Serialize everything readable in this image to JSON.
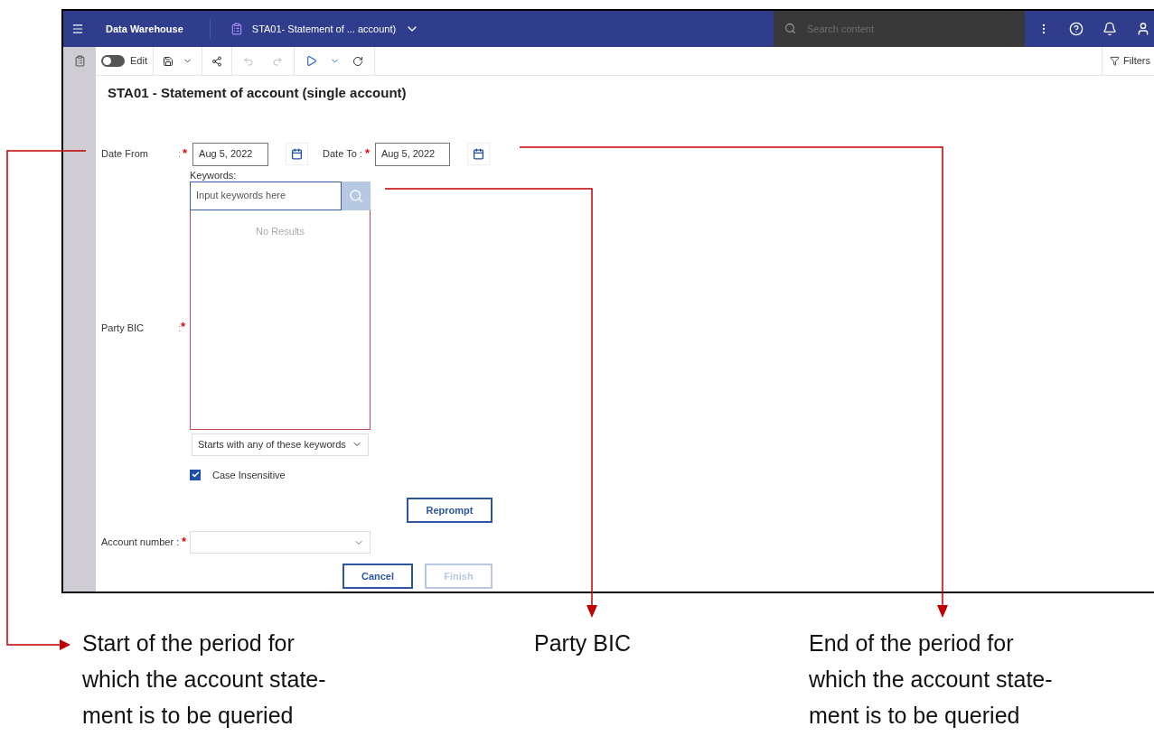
{
  "app_bar": {
    "title": "Data Warehouse",
    "report_tab": "STA01- Statement of ... account)",
    "search": {
      "placeholder": "Search content"
    }
  },
  "toolbar": {
    "edit_toggle": {
      "label": "Edit",
      "on": false
    },
    "filters": "Filters"
  },
  "report_title": "STA01 - Statement of account (single account)",
  "form": {
    "date_from": {
      "label": "Date From",
      "separator": ":",
      "required_mark": "*",
      "value": "Aug 5, 2022"
    },
    "date_to": {
      "label": "Date To :",
      "required_mark": "*",
      "value": "Aug 5, 2022"
    },
    "party_bic": {
      "label": "Party BIC",
      "separator": ":",
      "required_mark": "*",
      "keywords_label": "Keywords:",
      "keywords_placeholder": "Input keywords here",
      "empty_text": "No Results",
      "match_mode": "Starts with any of these keywords",
      "case_insensitive": {
        "label": "Case Insensitive",
        "checked": true
      },
      "reprompt": "Reprompt"
    },
    "account_number": {
      "label": "Account number :",
      "required_mark": "*"
    },
    "buttons": [
      {
        "label": "Cancel",
        "disabled": false
      },
      {
        "label": "Finish",
        "disabled": true
      }
    ]
  },
  "annotations": [
    "Start of the period for which the account state-ment is to be queried",
    "Party BIC",
    "End of the period for which the account state-ment is to be queried"
  ]
}
